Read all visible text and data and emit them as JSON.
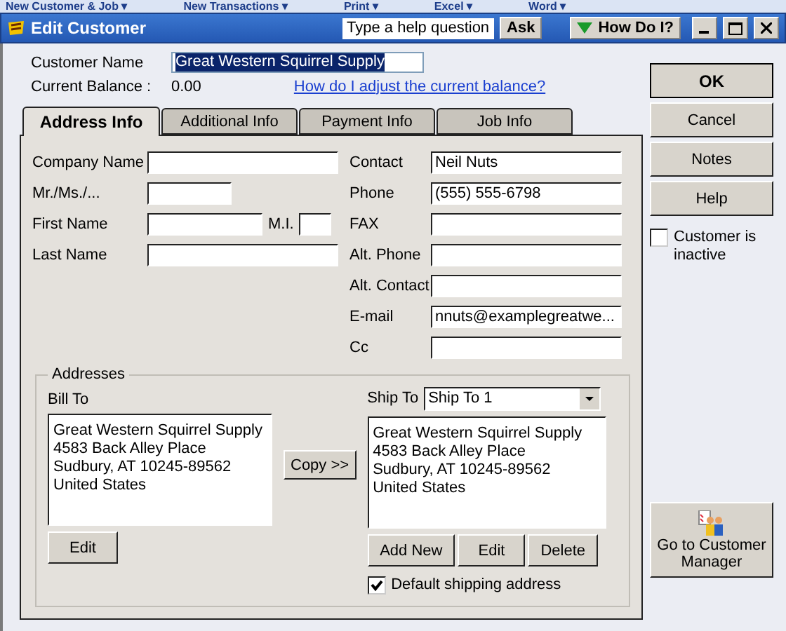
{
  "background_toolbar": [
    "New Customer & Job ▾",
    "New Transactions ▾",
    "Print ▾",
    "Excel ▾",
    "Word ▾"
  ],
  "window": {
    "title": "Edit Customer",
    "help_placeholder": "Type a help question",
    "ask_button": "Ask",
    "how_do_i_button": "How Do I?"
  },
  "customer_name": {
    "label": "Customer Name",
    "value": "Great Western Squirrel Supply",
    "selected": true
  },
  "current_balance": {
    "label": "Current Balance :",
    "value": "0.00",
    "link": "How do I adjust the current balance?"
  },
  "tabs": [
    {
      "label": "Address Info",
      "selected": true
    },
    {
      "label": "Additional Info",
      "selected": false
    },
    {
      "label": "Payment Info",
      "selected": false
    },
    {
      "label": "Job Info",
      "selected": false
    }
  ],
  "left_fields": [
    {
      "kind": "full",
      "label": "Company Name"
    },
    {
      "kind": "short",
      "label": "Mr./Ms./..."
    },
    {
      "kind": "with_mi",
      "label": "First Name",
      "mi_label": "M.I."
    },
    {
      "kind": "full",
      "label": "Last Name"
    }
  ],
  "right_fields": [
    {
      "label": "Contact",
      "value": "Neil Nuts"
    },
    {
      "label": "Phone",
      "value": "(555) 555-6798"
    },
    {
      "label": "FAX"
    },
    {
      "label": "Alt. Phone"
    },
    {
      "label": "Alt. Contact"
    },
    {
      "label": "E-mail",
      "value": "nnuts@examplegreatwe..."
    },
    {
      "label": "Cc"
    }
  ],
  "addresses": {
    "title": "Addresses",
    "bill_to": {
      "label": "Bill To",
      "lines": [
        "Great Western Squirrel Supply",
        "4583 Back Alley Place",
        "Sudbury, AT 10245-89562",
        "United States"
      ],
      "edit_button": "Edit"
    },
    "copy_button": "Copy >>",
    "ship_to": {
      "label": "Ship To",
      "selection": "Ship To 1",
      "lines": [
        "Great Western Squirrel Supply",
        "4583 Back Alley Place",
        "Sudbury, AT 10245-89562",
        "United States"
      ],
      "buttons": [
        "Add New",
        "Edit",
        "Delete"
      ]
    },
    "default_shipping": {
      "label": "Default shipping address",
      "checked": true
    }
  },
  "side_buttons": [
    {
      "label": "OK",
      "kind": "default"
    },
    {
      "label": "Cancel",
      "kind": "normal"
    },
    {
      "label": "Notes",
      "kind": "normal"
    },
    {
      "label": "Help",
      "kind": "normal"
    }
  ],
  "inactive": {
    "label": "Customer is inactive",
    "checked": false
  },
  "customer_manager_button": "Go to Customer Manager"
}
